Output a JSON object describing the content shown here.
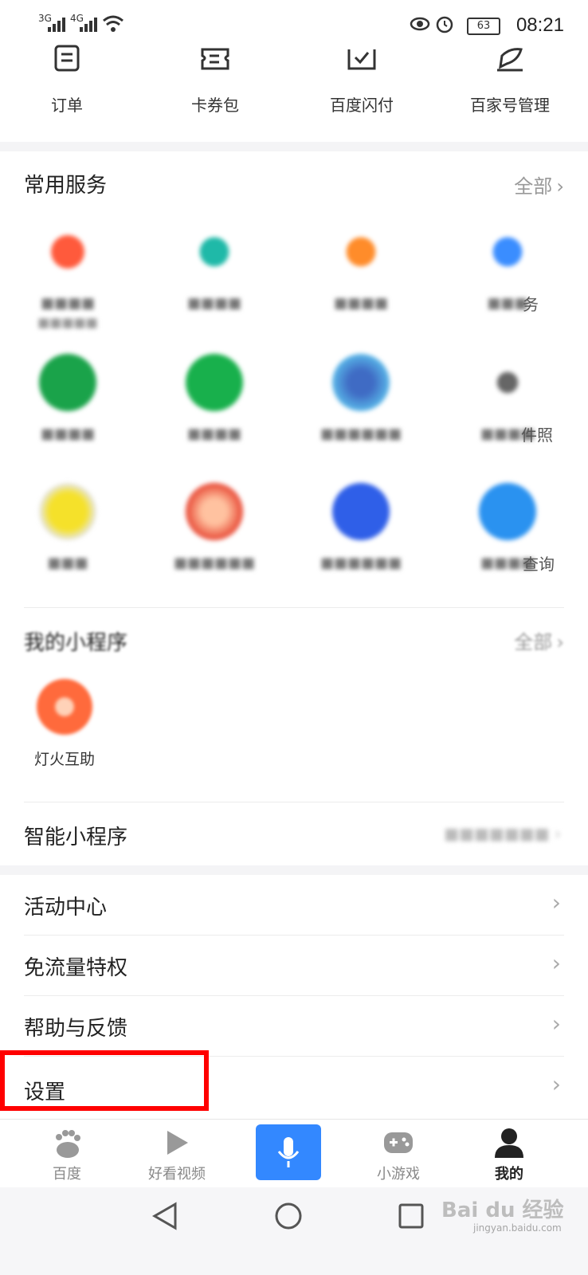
{
  "status": {
    "net1": "3G",
    "net2": "4G",
    "battery": "63",
    "time": "08:21"
  },
  "top_items": [
    "订单",
    "卡券包",
    "百度闪付",
    "百家号管理"
  ],
  "common_services": {
    "title": "常用服务",
    "more": "全部",
    "visible_fragments": [
      "务",
      "件照",
      "查询"
    ]
  },
  "mini_programs": {
    "title": "我的小程序",
    "more": "全部",
    "item": "灯火互助"
  },
  "smart_mini": {
    "title": "智能小程序"
  },
  "menu": [
    "活动中心",
    "免流量特权",
    "帮助与反馈",
    "设置"
  ],
  "tabs": [
    "百度",
    "好看视频",
    "小游戏",
    "我的"
  ],
  "watermark": {
    "brand": "Bai du 经验",
    "url": "jingyan.baidu.com"
  },
  "colors": {
    "accent": "#3388ff",
    "highlight": "#ff0000"
  }
}
